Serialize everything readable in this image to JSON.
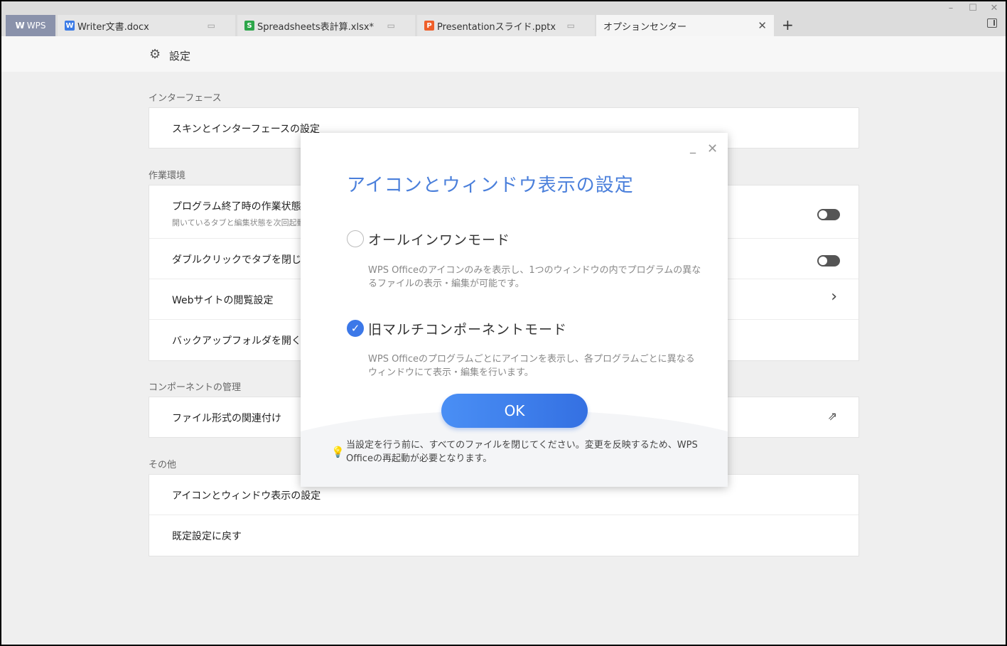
{
  "window": {
    "controls": {
      "minimize": "–",
      "maximize": "☐",
      "close": "✕"
    }
  },
  "tabs": [
    {
      "label": "WPS",
      "icon": "wps-logo-icon"
    },
    {
      "label": "Writer文書.docx",
      "icon": "writer-icon",
      "color": "#3b7be6"
    },
    {
      "label": "Spreadsheets表計算.xlsx*",
      "icon": "spreadsheet-icon",
      "color": "#2da64a"
    },
    {
      "label": "Presentationスライド.pptx",
      "icon": "presentation-icon",
      "color": "#ef5f2a"
    },
    {
      "label": "オプションセンター",
      "active": true
    }
  ],
  "header": {
    "title": "設定"
  },
  "sections": [
    {
      "title": "インターフェース",
      "items": [
        {
          "label": "スキンとインターフェースの設定"
        }
      ]
    },
    {
      "title": "作業環境",
      "items": [
        {
          "label": "プログラム終了時の作業状態を",
          "sub": "開いているタブと編集状態を次回起動",
          "control": "toggle",
          "state": "off"
        },
        {
          "label": "ダブルクリックでタブを閉じる",
          "control": "toggle",
          "state": "off"
        },
        {
          "label": "Webサイトの閲覧設定",
          "control": "chevron"
        },
        {
          "label": "バックアップフォルダを開く"
        }
      ]
    },
    {
      "title": "コンポーネントの管理",
      "items": [
        {
          "label": "ファイル形式の関連付け",
          "control": "external-link"
        }
      ]
    },
    {
      "title": "その他",
      "items": [
        {
          "label": "アイコンとウィンドウ表示の設定"
        },
        {
          "label": "既定設定に戻す"
        }
      ]
    }
  ],
  "dialog": {
    "title": "アイコンとウィンドウ表示の設定",
    "options": [
      {
        "label": "オールインワンモード",
        "checked": false,
        "desc": "WPS Officeのアイコンのみを表示し、1つのウィンドウの内でプログラムの異なるファイルの表示・編集が可能です。"
      },
      {
        "label": "旧マルチコンポーネントモード",
        "checked": true,
        "desc": "WPS Officeのプログラムごとにアイコンを表示し、各プログラムごとに異なるウィンドウにて表示・編集を行います。"
      }
    ],
    "ok_label": "OK",
    "note": "当設定を行う前に、すべてのファイルを閉じてください。変更を反映するため、WPS Officeの再起動が必要となります。"
  },
  "colors": {
    "accent": "#3c78e8",
    "title_blue": "#4a7fdb"
  }
}
